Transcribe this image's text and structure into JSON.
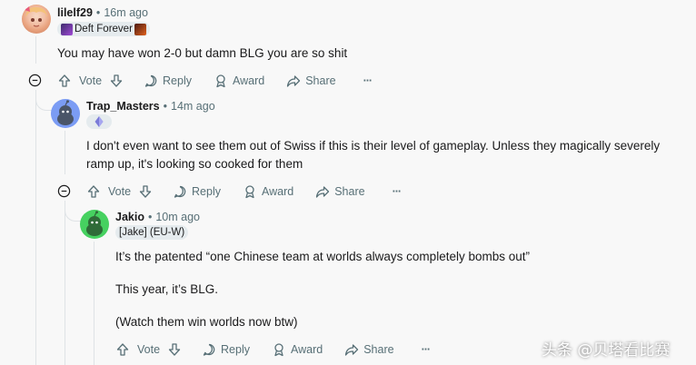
{
  "comments": [
    {
      "username": "lilelf29",
      "time": "16m ago",
      "flair": "Deft Forever",
      "body": [
        "You may have won 2-0 but damn BLG you are so shit"
      ]
    },
    {
      "username": "Trap_Masters",
      "time": "14m ago",
      "flair": "",
      "body": [
        "I don't even want to see them out of Swiss if this is their level of gameplay. Unless they magically severely ramp up, it's looking so cooked for them"
      ]
    },
    {
      "username": "Jakio",
      "time": "10m ago",
      "flair": "[Jake] (EU-W)",
      "body": [
        "It’s the patented “one Chinese team at worlds always completely bombs out”",
        "This year, it’s BLG.",
        "(Watch them win worlds now btw)"
      ]
    }
  ],
  "actions": {
    "vote": "Vote",
    "reply": "Reply",
    "award": "Award",
    "share": "Share",
    "more": "···"
  },
  "separator": "•",
  "watermark": "头条 @贝塔看比赛",
  "colors": {
    "background": "#f8f8f8",
    "meta": "#576f76",
    "flair_bg": "#e5ebee",
    "thread_line": "#dfe3e6",
    "avatar_trap": "#7b9cf4",
    "avatar_jakio": "#46d160"
  }
}
